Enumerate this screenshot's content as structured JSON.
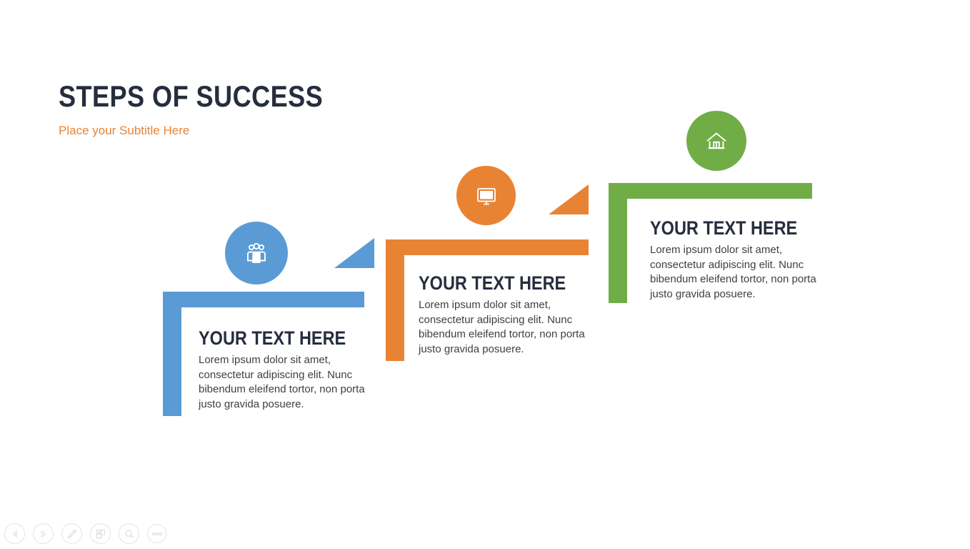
{
  "slide": {
    "title": "STEPS OF SUCCESS",
    "subtitle": "Place your Subtitle Here",
    "background_color": "#ffffff",
    "title_color": "#262d3d",
    "subtitle_color": "#e98334"
  },
  "steps": [
    {
      "id": "step-1",
      "color": "#5b9bd5",
      "icon": "people-group-icon",
      "heading": "YOUR TEXT HERE",
      "body": "Lorem ipsum dolor sit amet, consectetur adipiscing elit. Nunc bibendum eleifend tortor, non porta justo gravida posuere."
    },
    {
      "id": "step-2",
      "color": "#e98334",
      "icon": "desktop-monitor-icon",
      "heading": "YOUR TEXT HERE",
      "body": "Lorem ipsum dolor sit amet, consectetur adipiscing elit. Nunc bibendum eleifend tortor, non porta justo gravida posuere."
    },
    {
      "id": "step-3",
      "color": "#70ad47",
      "icon": "home-house-icon",
      "heading": "YOUR TEXT HERE",
      "body": "Lorem ipsum dolor sit amet, consectetur adipiscing elit. Nunc bibendum eleifend tortor, non porta justo gravida posuere."
    }
  ],
  "controls": [
    {
      "name": "previous-slide-button",
      "icon": "triangle-left-icon"
    },
    {
      "name": "next-slide-button",
      "icon": "triangle-right-icon"
    },
    {
      "name": "pen-annotate-button",
      "icon": "pen-icon"
    },
    {
      "name": "slide-grid-button",
      "icon": "grid-icon"
    },
    {
      "name": "zoom-button",
      "icon": "magnifier-icon"
    },
    {
      "name": "more-options-button",
      "icon": "ellipsis-icon"
    }
  ]
}
